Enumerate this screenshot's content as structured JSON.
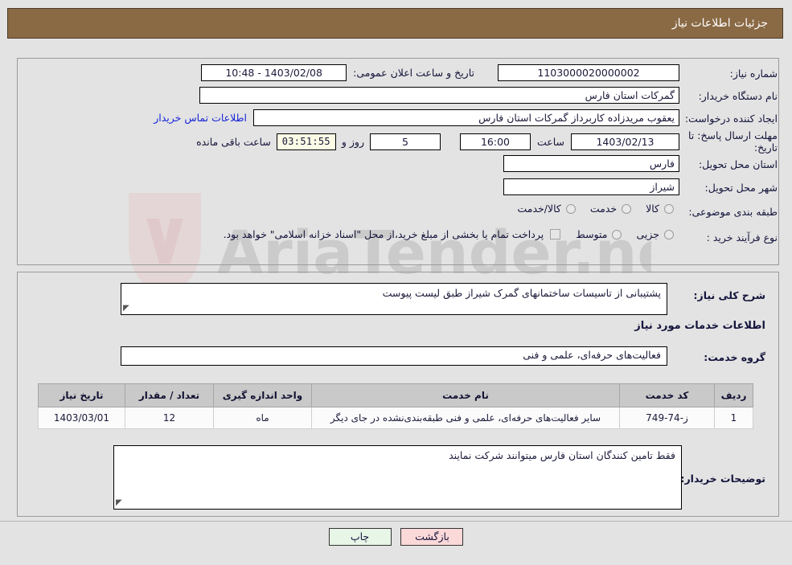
{
  "header": {
    "title": "جزئیات اطلاعات نیاز"
  },
  "fields": {
    "need_number": {
      "label": "شماره نیاز:",
      "value": "1103000020000002"
    },
    "buyer_org": {
      "label": "نام دستگاه خریدار:",
      "value": "گمرکات استان فارس"
    },
    "creator": {
      "label": "ایجاد کننده درخواست:",
      "value": "یعقوب مریدزاده کاربرداز گمرکات استان فارس"
    },
    "contact_link": "اطلاعات تماس خریدار",
    "public_announce": {
      "label": "تاریخ و ساعت اعلان عمومی:",
      "value": "1403/02/08 - 10:48"
    },
    "deadline": {
      "label_line1": "مهلت ارسال پاسخ: تا",
      "label_line2": "تاریخ:",
      "date": "1403/02/13",
      "hour_label": "ساعت",
      "hour": "16:00",
      "days": "5",
      "days_label": "روز و",
      "timer": "03:51:55",
      "timer_label": "ساعت باقی مانده"
    },
    "province": {
      "label": "استان محل تحویل:",
      "value": "فارس"
    },
    "city": {
      "label": "شهر محل تحویل:",
      "value": "شیراز"
    },
    "category": {
      "label": "طبقه بندی موضوعی:",
      "options": [
        "کالا",
        "خدمت",
        "کالا/خدمت"
      ],
      "selected": ""
    },
    "process_type": {
      "label": "نوع فرآیند خرید :",
      "options": [
        "جزیی",
        "متوسط"
      ],
      "selected": "",
      "checkbox_note": "پرداخت تمام یا بخشی از مبلغ خرید،از محل \"اسناد خزانه اسلامی\" خواهد بود."
    }
  },
  "description": {
    "label": "شرح کلی نیاز:",
    "value": "پشتیبانی از تاسیسات ساختمانهای گمرک شیراز  طبق لیست پیوست"
  },
  "services_section": {
    "heading": "اطلاعات خدمات مورد نیاز",
    "group_label": "گروه خدمت:",
    "group_value": "فعالیت‌های حرفه‌ای، علمی و فنی"
  },
  "table": {
    "columns": [
      "ردیف",
      "کد خدمت",
      "نام خدمت",
      "واحد اندازه گیری",
      "تعداد / مقدار",
      "تاریخ نیاز"
    ],
    "rows": [
      {
        "row_no": "1",
        "service_code": "ز-74-749",
        "service_name": "سایر فعالیت‌های حرفه‌ای، علمی و فنی طبقه‌بندی‌نشده در جای دیگر",
        "unit": "ماه",
        "quantity": "12",
        "need_date": "1403/03/01"
      }
    ]
  },
  "buyer_notes": {
    "label": "توضیحات خریدار:",
    "value": "فقط تامین کنندگان استان فارس میتوانند شرکت نمایند"
  },
  "buttons": {
    "print": "چاپ",
    "back": "بازگشت"
  },
  "watermark": {
    "text": "AriaTender.net"
  }
}
